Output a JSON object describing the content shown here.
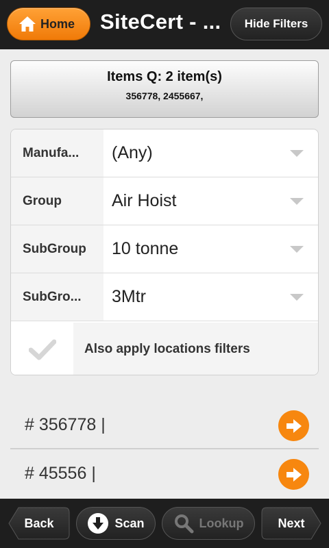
{
  "header": {
    "home_label": "Home",
    "title": "SiteCert - ...",
    "hide_filters_label": "Hide Filters"
  },
  "items_queue": {
    "title": "Items Q: 2 item(s)",
    "ids": "356778, 2455667,"
  },
  "filters": [
    {
      "label": "Manufa...",
      "value": "(Any)"
    },
    {
      "label": "Group",
      "value": "Air Hoist"
    },
    {
      "label": "SubGroup",
      "value": "10 tonne"
    },
    {
      "label": "SubGro...",
      "value": "3Mtr"
    }
  ],
  "location_filter": {
    "label": "Also apply locations filters",
    "checked": false
  },
  "results": [
    {
      "text": "# 356778 |"
    },
    {
      "text": "# 45556 |"
    }
  ],
  "footer": {
    "back_label": "Back",
    "scan_label": "Scan",
    "lookup_label": "Lookup",
    "next_label": "Next"
  },
  "colors": {
    "accent": "#f7870f",
    "bar": "#1e1e1e"
  },
  "icons": [
    "home-icon",
    "chevron-down-icon",
    "checkmark-icon",
    "arrow-right-icon",
    "download-arrow-icon",
    "search-icon"
  ]
}
